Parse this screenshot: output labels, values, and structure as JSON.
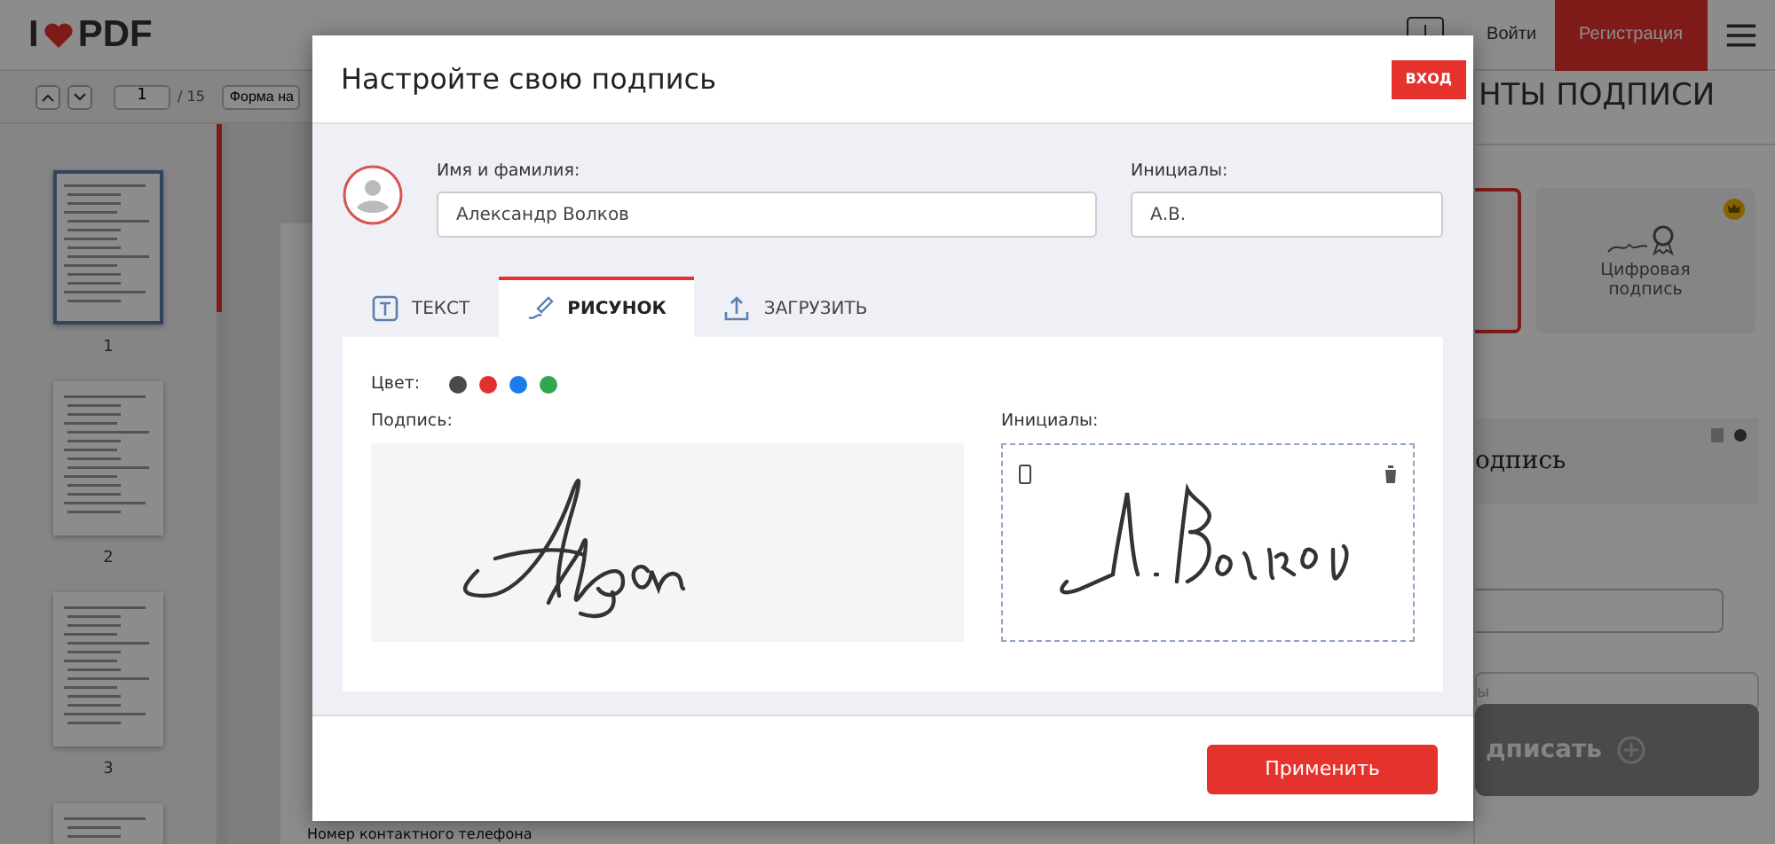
{
  "app_header": {
    "logo_prefix": "I",
    "logo_suffix": "PDF",
    "login": "Войти",
    "signup": "Регистрация"
  },
  "viewer_toolbar": {
    "page": "1",
    "page_count": "/ 15",
    "form_button": "Форма на"
  },
  "thumbnails": [
    {
      "label": "1",
      "selected": true
    },
    {
      "label": "2",
      "selected": false
    },
    {
      "label": "3",
      "selected": false
    },
    {
      "selected": false
    }
  ],
  "document": {
    "footer_text": "Номер контактного телефона"
  },
  "right_panel": {
    "title": "НТЫ ПОДПИСИ",
    "signature_types": [
      {
        "kind": "simple",
        "selected": true
      },
      {
        "kind": "digital",
        "label": "Цифровая подпись",
        "selected": false,
        "premium": true
      }
    ],
    "saved_signature": "одпись",
    "inputs": [
      {
        "placeholder": "ы"
      }
    ],
    "sign_button": "дписать"
  },
  "modal": {
    "title": "Настройте свою подпись",
    "login_button": "ВХОД",
    "name_field": {
      "label": "Имя и фамилия:",
      "value": "Александр Волков"
    },
    "initials_field": {
      "label": "Инициалы:",
      "value": "А.В."
    },
    "tabs": [
      {
        "kind": "text",
        "label": "ТЕКСТ",
        "selected": false
      },
      {
        "kind": "draw",
        "label": "РИСУНОК",
        "selected": true
      },
      {
        "kind": "upload",
        "label": "ЗАГРУЗИТЬ",
        "selected": false
      }
    ],
    "color_label": "Цвет:",
    "colors": [
      {
        "color": "#4a4a4a"
      },
      {
        "color": "#e03131"
      },
      {
        "color": "#1c7ced"
      },
      {
        "color": "#2fa84f"
      }
    ],
    "signature_label": "Подпись:",
    "initials_label": "Инициалы:",
    "apply_button": "Применить"
  }
}
